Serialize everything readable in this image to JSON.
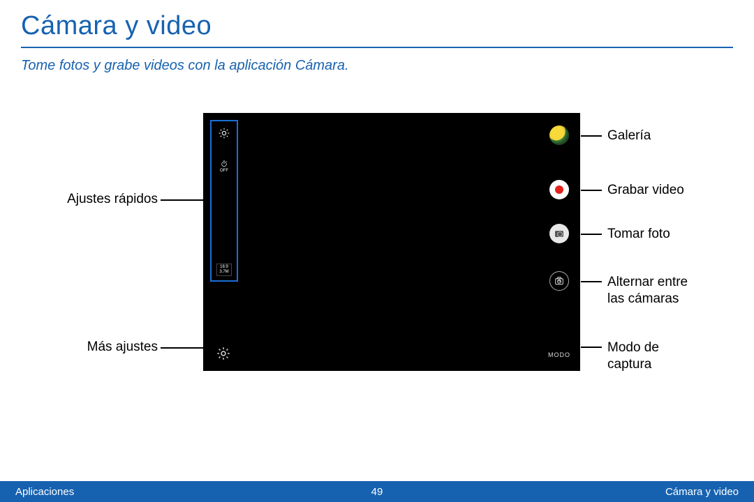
{
  "header": {
    "title": "Cámara y video",
    "subtitle": "Tome fotos y grabe videos con la aplicación Cámara."
  },
  "callouts": {
    "left": {
      "quick_settings": "Ajustes rápidos",
      "more_settings": "Más ajustes"
    },
    "right": {
      "gallery": "Galería",
      "record_video": "Grabar video",
      "take_photo": "Tomar foto",
      "switch_camera": "Alternar entre\nlas cámaras",
      "capture_mode": "Modo de\ncaptura"
    }
  },
  "camera_ui": {
    "quick_settings_panel": {
      "timer_label": "OFF",
      "aspect_ratio": "16:9",
      "resolution": "3.7M"
    },
    "mode_button_label": "MODO"
  },
  "footer": {
    "left": "Aplicaciones",
    "page_number": "49",
    "right": "Cámara y video"
  }
}
